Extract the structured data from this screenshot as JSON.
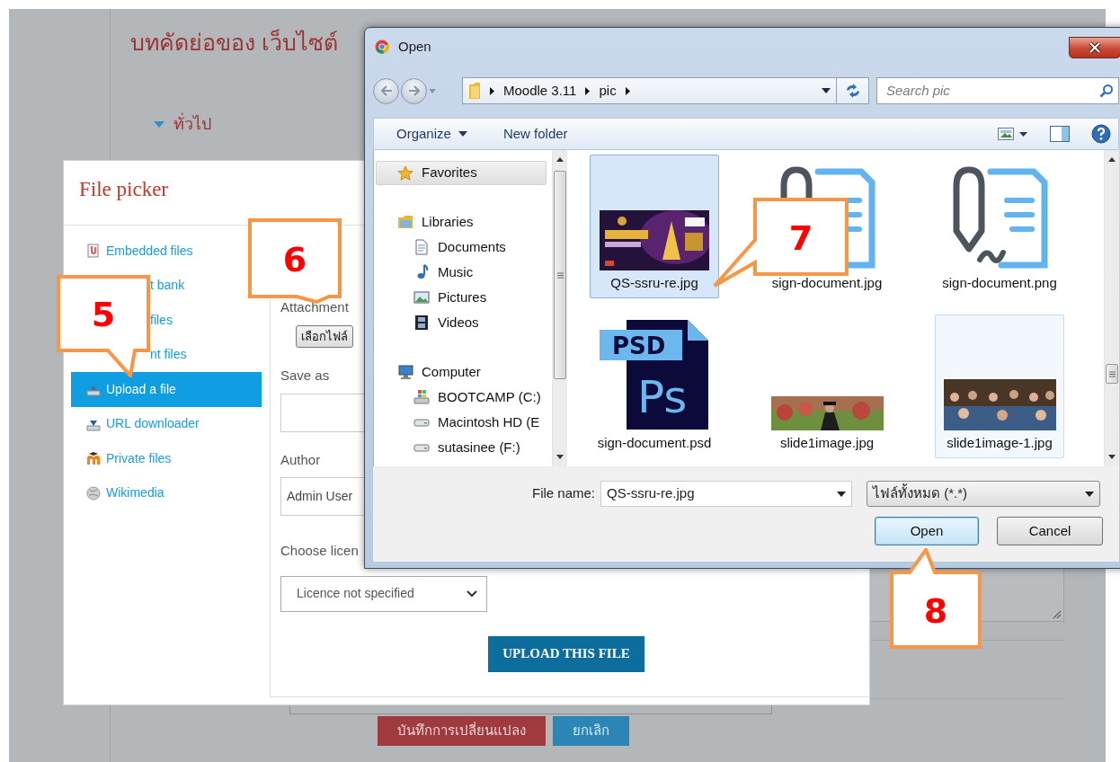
{
  "page": {
    "title": "บทคัดย่อของ เว็บไซต์",
    "section": {
      "label": "ทั่วไป",
      "expanded": true
    },
    "buttons": [
      {
        "label": "บันทึกการเปลี่ยนแปลง",
        "kind": "save"
      },
      {
        "label": "ยกเลิก",
        "kind": "cancel"
      }
    ]
  },
  "file_picker": {
    "title": "File picker",
    "repositories": [
      {
        "label": "Embedded files",
        "kind": "full",
        "selected": false
      },
      {
        "label": "t bank",
        "kind": "partial",
        "selected": false
      },
      {
        "label": "files",
        "kind": "partial",
        "selected": false
      },
      {
        "label": "nt files",
        "kind": "partial",
        "selected": false
      },
      {
        "label": "Upload a file",
        "kind": "full",
        "selected": true
      },
      {
        "label": "URL downloader",
        "kind": "full",
        "selected": false
      },
      {
        "label": "Private files",
        "kind": "full",
        "selected": false
      },
      {
        "label": "Wikimedia",
        "kind": "full",
        "selected": false
      }
    ],
    "form": {
      "attachment_label": "Attachment",
      "choose_button": "เลือกไฟล์",
      "save_as_label": "Save as",
      "author_label": "Author",
      "author_value": "Admin User",
      "licence_label": "Choose licen",
      "licence_value": "Licence not specified",
      "upload_button": "UPLOAD THIS FILE"
    }
  },
  "open_dialog": {
    "title": "Open",
    "path": [
      "Moodle 3.11",
      "pic"
    ],
    "search": {
      "placeholder": "Search pic"
    },
    "toolbar": [
      {
        "label": "Organize",
        "kind": "menu"
      },
      {
        "label": "New folder",
        "kind": "button"
      }
    ],
    "nav": [
      {
        "label": "Favorites",
        "selected": true
      },
      {
        "label": "Libraries",
        "selected": false,
        "children": [
          {
            "label": "Documents",
            "selected": false
          },
          {
            "label": "Music",
            "selected": false
          },
          {
            "label": "Pictures",
            "selected": false
          },
          {
            "label": "Videos",
            "selected": false
          }
        ]
      },
      {
        "label": "Computer",
        "selected": false,
        "children": [
          {
            "label": "BOOTCAMP (C:)",
            "selected": false
          },
          {
            "label": "Macintosh HD (E",
            "selected": false
          },
          {
            "label": "sutasinee (F:)",
            "selected": false
          }
        ]
      }
    ],
    "files": [
      {
        "name": "QS-ssru-re.jpg",
        "kind": "picture",
        "selected": true,
        "hovered": false
      },
      {
        "name": "sign-document.jpg",
        "kind": "sign",
        "selected": false,
        "hovered": false
      },
      {
        "name": "sign-document.png",
        "kind": "sign",
        "selected": false,
        "hovered": false
      },
      {
        "name": "sign-document.psd",
        "kind": "psd",
        "badge": "PSD",
        "glyph": "Ps",
        "selected": false,
        "hovered": false
      },
      {
        "name": "slide1image.jpg",
        "kind": "picture",
        "selected": false,
        "hovered": false
      },
      {
        "name": "slide1image-1.jpg",
        "kind": "picture",
        "selected": false,
        "hovered": true
      }
    ],
    "file_name": {
      "label": "File name:",
      "value": "QS-ssru-re.jpg"
    },
    "file_type": "ไฟล์ทั้งหมด (*.*)",
    "buttons": [
      {
        "label": "Open",
        "focused": true
      },
      {
        "label": "Cancel",
        "focused": false
      }
    ]
  },
  "callouts": [
    "5",
    "6",
    "7",
    "8"
  ]
}
